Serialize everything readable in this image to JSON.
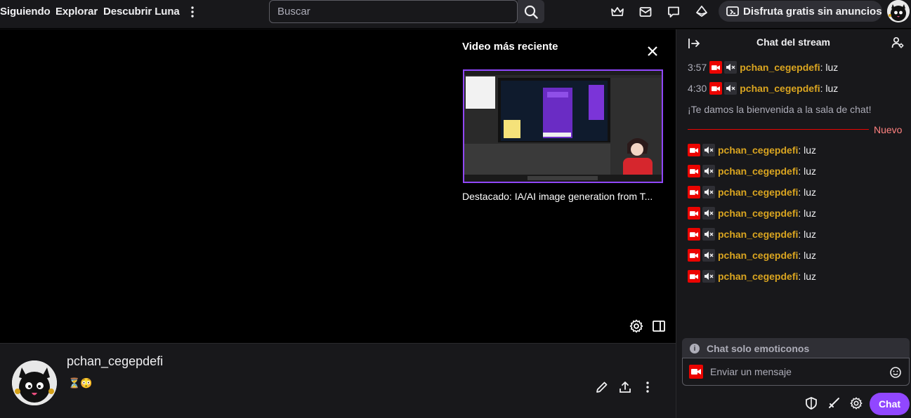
{
  "nav": {
    "following": "Siguiendo",
    "browse": "Explorar",
    "luna": "Descubrir Luna",
    "search_placeholder": "Buscar",
    "promo_label": "Disfruta gratis sin anuncios"
  },
  "player": {
    "recent_title": "Video más reciente",
    "recent_caption": "Destacado: IA/AI image generation from T..."
  },
  "channel": {
    "name": "pchan_cegepdefi",
    "emotes": "⏳😳"
  },
  "chat": {
    "title": "Chat del stream",
    "welcome": "¡Te damos la bienvenida a la sala de chat!",
    "new_label": "Nuevo",
    "messages": [
      {
        "time": "3:57",
        "user": "pchan_cegepdefi",
        "text": ": luz"
      },
      {
        "time": "4:30",
        "user": "pchan_cegepdefi",
        "text": ": luz"
      },
      {
        "time": "",
        "user": "pchan_cegepdefi",
        "text": ": luz"
      },
      {
        "time": "",
        "user": "pchan_cegepdefi",
        "text": ": luz"
      },
      {
        "time": "",
        "user": "pchan_cegepdefi",
        "text": ": luz"
      },
      {
        "time": "",
        "user": "pchan_cegepdefi",
        "text": ": luz"
      },
      {
        "time": "",
        "user": "pchan_cegepdefi",
        "text": ": luz"
      },
      {
        "time": "",
        "user": "pchan_cegepdefi",
        "text": ": luz"
      },
      {
        "time": "",
        "user": "pchan_cegepdefi",
        "text": ": luz"
      }
    ],
    "emote_only": "Chat solo emoticonos",
    "input_placeholder": "Enviar un mensaje",
    "send_label": "Chat"
  },
  "colors": {
    "accent": "#9147ff",
    "live_red": "#eb0400",
    "username": "#daa520",
    "background": "#0e0e10",
    "surface": "#18181b"
  },
  "icons": [
    "more-vertical-icon",
    "search-icon",
    "crown-icon",
    "inbox-icon",
    "whispers-icon",
    "bits-icon",
    "ad-free-icon",
    "close-icon",
    "settings-icon",
    "theatre-mode-icon",
    "edit-icon",
    "share-icon",
    "collapse-icon",
    "community-icon",
    "camera-icon",
    "mute-icon",
    "info-icon",
    "emoji-icon",
    "moderation-shield-icon",
    "sword-icon"
  ]
}
